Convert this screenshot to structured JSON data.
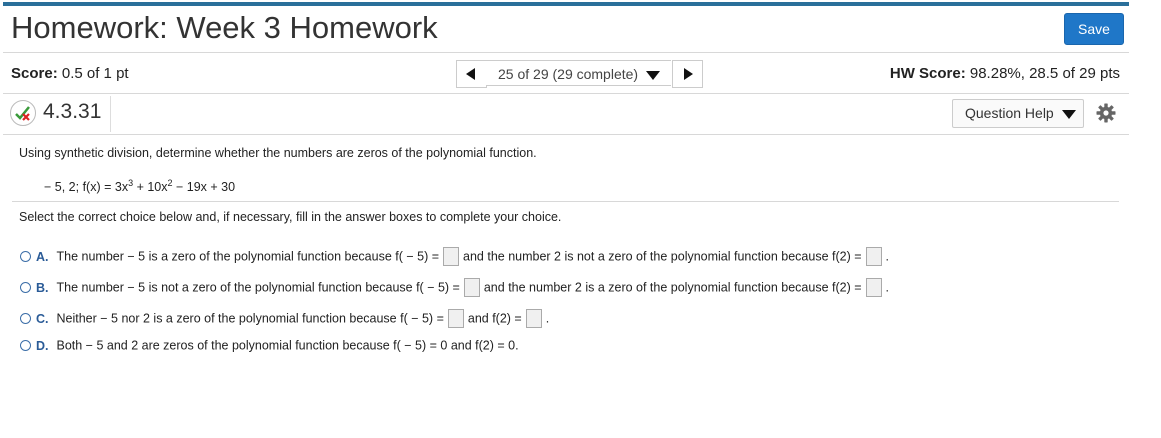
{
  "header": {
    "title": "Homework: Week 3 Homework",
    "save_label": "Save"
  },
  "status": {
    "score_label": "Score:",
    "score_value": "0.5 of 1 pt",
    "nav_label": "25 of 29 (29 complete)",
    "hw_score_label": "HW Score:",
    "hw_score_value": "98.28%, 28.5 of 29 pts"
  },
  "question": {
    "number": "4.3.31",
    "help_label": "Question Help",
    "instruction": "Using synthetic division, determine whether the numbers are zeros of the polynomial function.",
    "poly_prefix": "− 5, 2; f(x) = 3x",
    "poly_exp1": "3",
    "poly_mid": " + 10x",
    "poly_exp2": "2",
    "poly_suffix": " − 19x + 30",
    "select_prompt": "Select the correct choice below and, if necessary, fill in the answer boxes to complete your choice."
  },
  "choices": [
    {
      "letter": "A.",
      "part1": "The number  − 5 is a zero of the polynomial function because f( − 5) =",
      "part2": "and the number 2 is not a zero of the polynomial function because f(2) =",
      "part3": "."
    },
    {
      "letter": "B.",
      "part1": "The number  − 5 is not a zero of the polynomial function because f( − 5) =",
      "part2": "and the number 2 is a zero of the polynomial function because f(2) =",
      "part3": "."
    },
    {
      "letter": "C.",
      "part1": "Neither − 5 nor 2 is a zero of the polynomial function because f( − 5) =",
      "part2": "and f(2) =",
      "part3": "."
    },
    {
      "letter": "D.",
      "part1": "Both  − 5 and 2 are zeros of the polynomial function because f( − 5) = 0 and f(2) = 0."
    }
  ],
  "colors": {
    "accent_bar": "#2a6f9a",
    "save_button": "#1f77c8",
    "choice_letter": "#2a5b97"
  }
}
